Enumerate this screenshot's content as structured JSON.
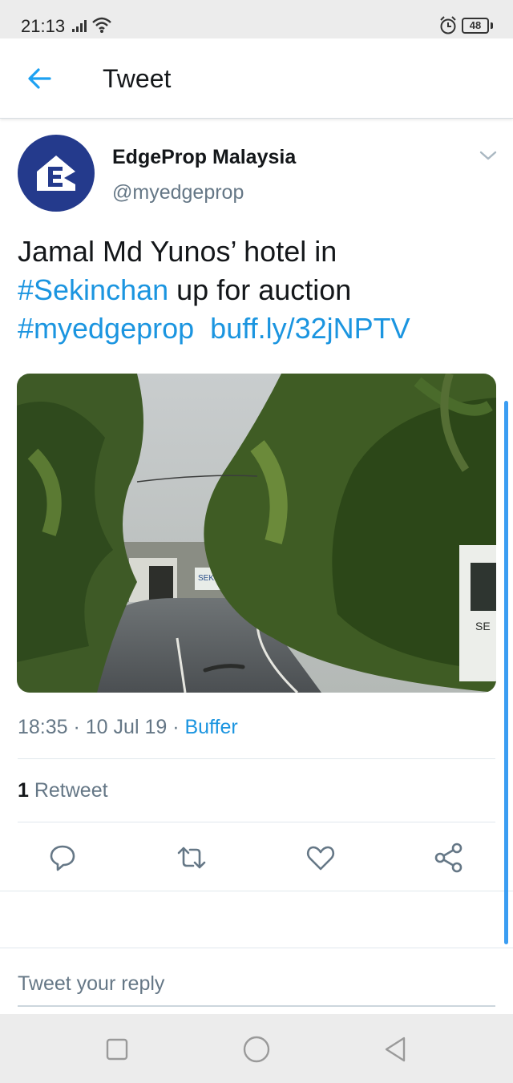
{
  "status_bar": {
    "time": "21:13",
    "battery": "48",
    "icons": [
      "signal-icon",
      "wifi-icon",
      "alarm-icon",
      "battery-icon"
    ]
  },
  "header": {
    "title": "Tweet",
    "back_icon": "arrow-left-icon"
  },
  "tweet": {
    "author": {
      "display_name": "EdgeProp Malaysia",
      "handle": "@myedgeprop",
      "avatar_letter": "E"
    },
    "text": {
      "line1": "Jamal Md Yunos’ hotel in",
      "hashtag1": "#Sekinchan",
      "line2_rest": " up for auction",
      "hashtag2": "#myedgeprop",
      "link": "buff.ly/32jNPTV"
    },
    "meta": {
      "time": "18:35",
      "sep1": " · ",
      "date": "10 Jul 19",
      "sep2": " · ",
      "source": "Buffer"
    },
    "retweet_count": "1",
    "retweet_label": " Retweet",
    "media": {
      "sign_text_left": "SEKIN",
      "sign_text_right": "SE"
    }
  },
  "actions": [
    "reply-icon",
    "retweet-icon",
    "like-icon",
    "share-icon"
  ],
  "reply": {
    "placeholder": "Tweet your reply"
  },
  "nav": [
    "recent-apps-icon",
    "home-icon",
    "back-icon"
  ],
  "colors": {
    "accent": "#1b95e0",
    "text": "#14171a",
    "secondary": "#657786",
    "avatar_bg": "#243a8c"
  }
}
